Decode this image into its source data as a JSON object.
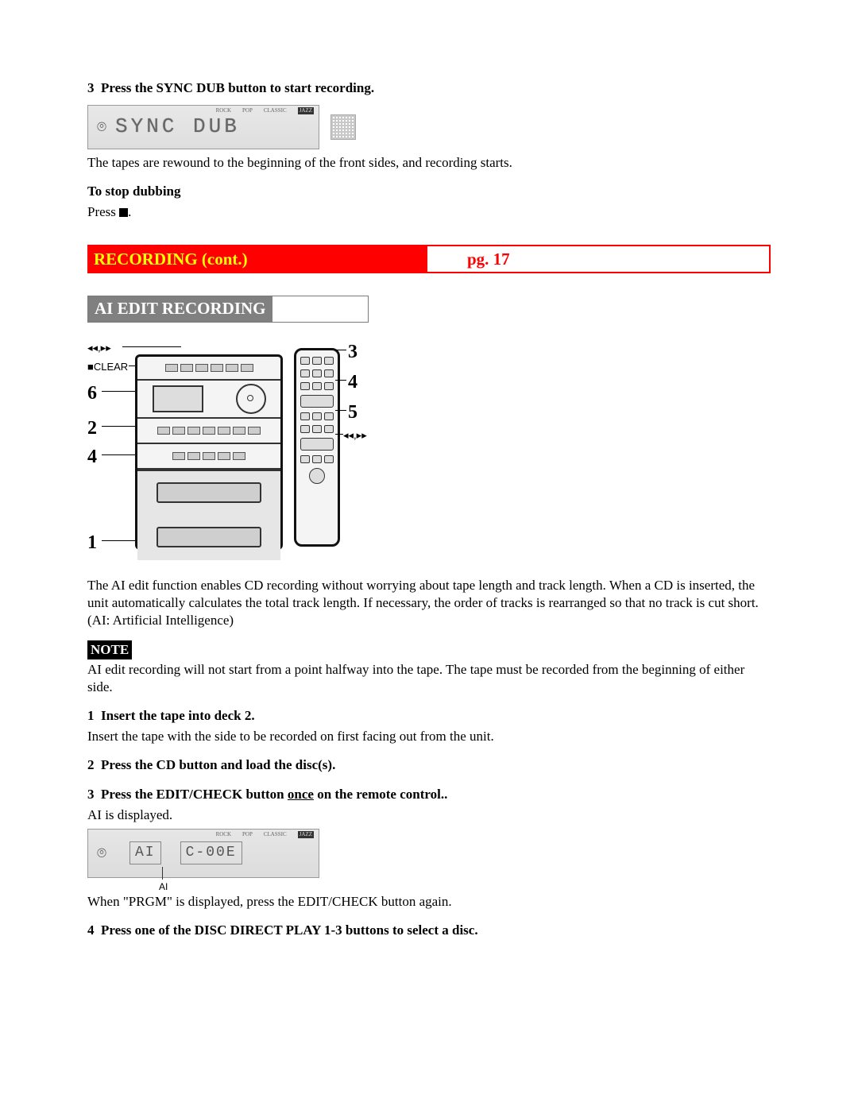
{
  "step3_top": {
    "num": "3",
    "headline": "Press the SYNC DUB button to start recording.",
    "lcd_modes": [
      "ROCK",
      "POP",
      "CLASSIC",
      "JAZZ"
    ],
    "lcd_text": "SYNC DUB",
    "after": "The tapes are rewound to the beginning of the front sides, and recording starts."
  },
  "stop": {
    "heading": "To stop dubbing",
    "press_prefix": "Press ",
    "press_suffix": "."
  },
  "section_bar": {
    "title": "RECORDING (cont.)",
    "page": "pg. 17"
  },
  "ai_heading": "AI EDIT RECORDING",
  "figure": {
    "left_label_top": "◂◂,▸▸",
    "left_label_clear": "■CLEAR",
    "callout_6": "6",
    "callout_2": "2",
    "callout_4l": "4",
    "callout_1": "1",
    "callout_3": "3",
    "callout_4r": "4",
    "callout_5": "5",
    "right_label": "◂◂,▸▸"
  },
  "ai_desc": "The AI edit function enables CD recording without worrying about tape length and track length.  When a CD is inserted, the unit automatically calculates the total track length.  If necessary, the order of tracks is rearranged so that no track is cut short. (AI: Artificial Intelligence)",
  "note": {
    "label": "NOTE",
    "body": "AI edit recording will not start from a point halfway into the tape.  The tape must be recorded from the beginning of either side."
  },
  "step1": {
    "num": "1",
    "headline": "Insert the tape into deck 2.",
    "body": "Insert the tape with the side to be recorded on first facing out from the unit."
  },
  "step2": {
    "num": "2",
    "headline": "Press the CD button and load the disc(s)."
  },
  "step3b": {
    "num": "3",
    "prefix": "Press the EDIT/CHECK button ",
    "underlined": "once",
    "suffix": " on the remote control..",
    "body": "AI is displayed.",
    "lcd_modes": [
      "ROCK",
      "POP",
      "CLASSIC",
      "JAZZ"
    ],
    "lcd_seg1": "AI",
    "lcd_seg2": "C-00E",
    "sub_label": "AI",
    "after": "When \"PRGM\" is displayed, press the EDIT/CHECK button again."
  },
  "step4": {
    "num": "4",
    "headline": "Press one of the DISC DIRECT PLAY 1-3 buttons to select a disc."
  }
}
